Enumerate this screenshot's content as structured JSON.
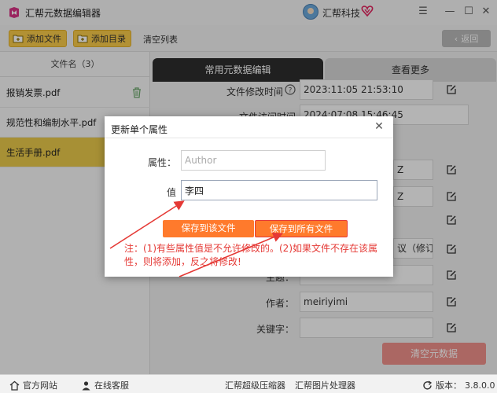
{
  "window": {
    "title": "汇帮元数据编辑器",
    "user_name": "汇帮科技",
    "controls": {
      "menu": "☰",
      "minimize": "—",
      "maximize": "☐",
      "close": "✕"
    }
  },
  "toolbar": {
    "add_file": "添加文件",
    "add_folder": "添加目录",
    "clear_list": "清空列表",
    "back": "返回"
  },
  "file_list": {
    "header": "文件名（3）",
    "files": [
      {
        "name": "报销发票.pdf"
      },
      {
        "name": "规范性和编制水平.pdf"
      },
      {
        "name": "生活手册.pdf"
      }
    ]
  },
  "tabs": {
    "common": "常用元数据编辑",
    "more": "查看更多"
  },
  "properties": {
    "modified_time_label": "文件修改时间",
    "modified_time_value": "2023:11:05 21:53:10",
    "access_time_label": "文件访问时间",
    "access_time_value": "2024:07:08 15:46:45",
    "row3_value": "Z",
    "row4_value": "Z",
    "row5_value": "议（修订版",
    "subject_label": "主题：",
    "author_label": "作者：",
    "author_value": "meiriyimi",
    "keywords_label": "关键字：",
    "clear_meta": "清空元数据"
  },
  "dialog": {
    "title": "更新单个属性",
    "close": "✕",
    "attr_label": "属性：",
    "attr_placeholder": "Author",
    "value_label": "值",
    "value": "李四",
    "save_this": "保存到该文件",
    "save_all": "保存到所有文件",
    "note_line1": "注：(1)有些属性值是不允许修改的。(2)如果文件不存在该属",
    "note_line2": "性，则将添加，反之将修改!"
  },
  "statusbar": {
    "website": "官方网站",
    "support": "在线客服",
    "compressor": "汇帮超级压缩器",
    "image_tool": "汇帮图片处理器",
    "version_label": "版本：",
    "version": "3.8.0.0"
  },
  "colors": {
    "accent_yellow": "#f7c948",
    "dark_tab": "#2d2d2d",
    "orange_button": "#ff7a2c",
    "note_red": "#e53935",
    "clear_button": "#ed8f8a"
  }
}
